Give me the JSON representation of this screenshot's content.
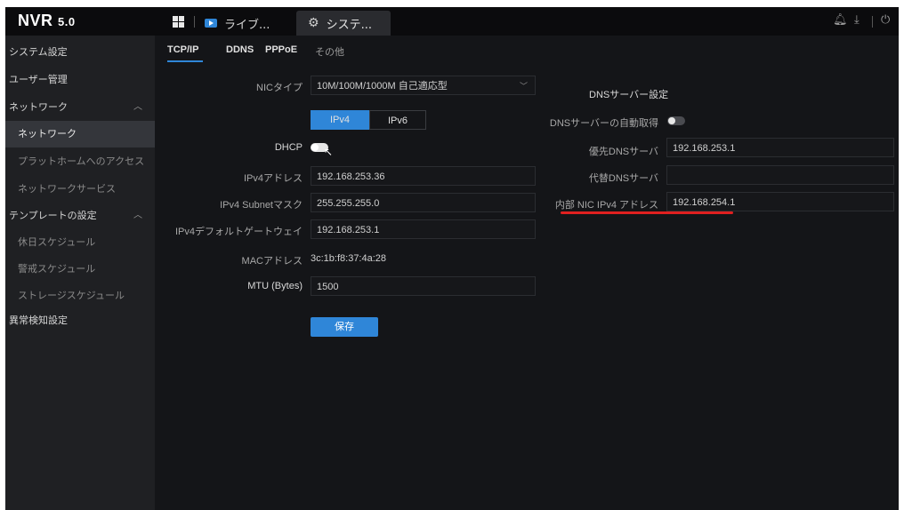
{
  "header": {
    "logo": "NVR",
    "logo_version": "5.0",
    "tabs": [
      {
        "label": "ライブ..."
      },
      {
        "label": "システ..."
      }
    ],
    "icons": [
      "bell-icon",
      "download-icon",
      "power-icon"
    ]
  },
  "sidebar": {
    "items": [
      {
        "label": "システム設定"
      },
      {
        "label": "ユーザー管理"
      },
      {
        "label": "ネットワーク"
      },
      {
        "label": "ネットワーク"
      },
      {
        "label": "プラットホームへのアクセス"
      },
      {
        "label": "ネットワークサービス"
      },
      {
        "label": "テンプレートの設定"
      },
      {
        "label": "休日スケジュール"
      },
      {
        "label": "警戒スケジュール"
      },
      {
        "label": "ストレージスケジュール"
      },
      {
        "label": "異常検知設定"
      }
    ]
  },
  "subtabs": [
    "TCP/IP",
    "DDNS",
    "PPPoE",
    "その他"
  ],
  "tcpip": {
    "nic_type_label": "NICタイプ",
    "nic_type_value": "10M/100M/1000M 自己適応型",
    "ipv4_label": "IPv4",
    "ipv6_label": "IPv6",
    "dhcp_label": "DHCP",
    "dhcp_enabled": false,
    "ipv4_address_label": "IPv4アドレス",
    "ipv4_address_value": "192.168.253.36",
    "subnet_label": "IPv4 Subnetマスク",
    "subnet_value": "255.255.255.0",
    "gateway_label": "IPv4デフォルトゲートウェイ",
    "gateway_value": "192.168.253.1",
    "mac_label": "MACアドレス",
    "mac_value": "3c:1b:f8:37:4a:28",
    "mtu_label": "MTU (Bytes)",
    "mtu_value": "1500",
    "save_label": "保存"
  },
  "dns": {
    "title": "DNSサーバー設定",
    "auto_label": "DNSサーバーの自動取得",
    "auto_enabled": false,
    "preferred_label": "優先DNSサーバ",
    "preferred_value": "192.168.253.1",
    "alternate_label": "代替DNSサーバ",
    "alternate_value": "",
    "internal_nic_label": "内部 NIC IPv4 アドレス",
    "internal_nic_value": "192.168.254.1"
  },
  "colors": {
    "accent": "#2f86d8",
    "annotation": "#e02020"
  }
}
